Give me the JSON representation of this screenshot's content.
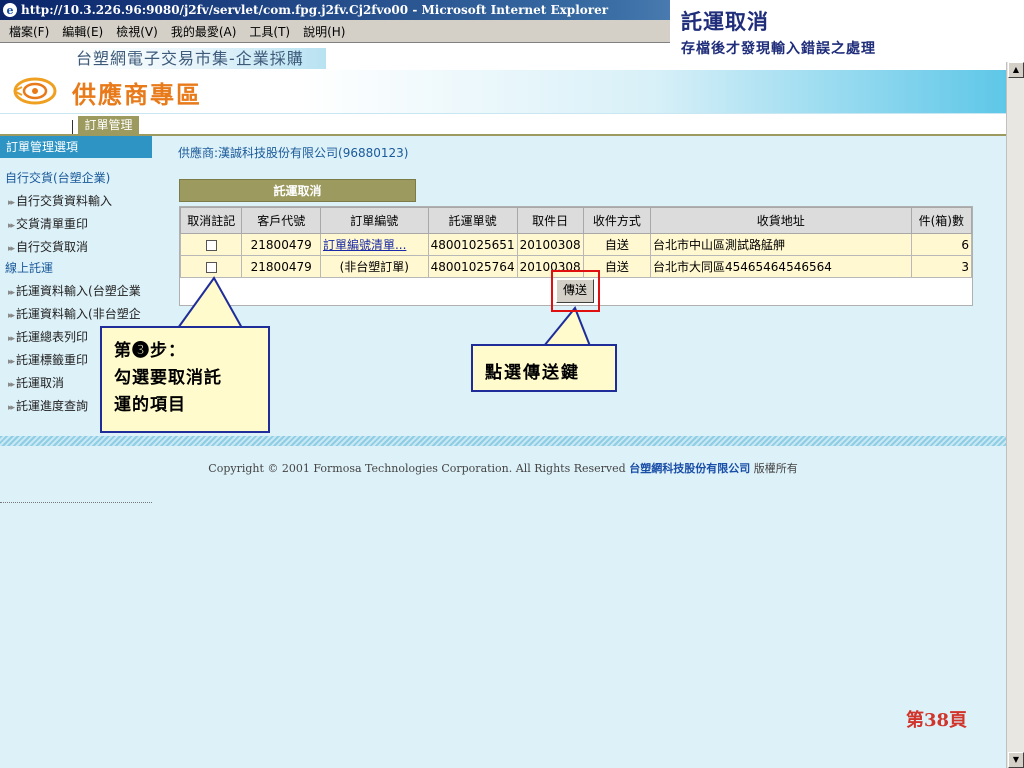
{
  "browser": {
    "title": "http://10.3.226.96:9080/j2fv/servlet/com.fpg.j2fv.Cj2fvo00 - Microsoft Internet Explorer",
    "menu": [
      "檔案(F)",
      "編輯(E)",
      "檢視(V)",
      "我的最愛(A)",
      "工具(T)",
      "說明(H)"
    ]
  },
  "slide": {
    "title": "託運取消",
    "subtitle": "存檔後才發現輸入錯誤之處理",
    "page": "第38頁"
  },
  "site": {
    "market": "台塑網電子交易市集-企業採購",
    "brand": "供應商專區",
    "active_tab": "訂單管理"
  },
  "nav": {
    "header": "訂單管理選項",
    "group1": "自行交貨(台塑企業)",
    "group1_items": [
      "自行交貨資料輸入",
      "交貨清單重印",
      "自行交貨取消"
    ],
    "group2": "線上託運",
    "group2_items": [
      "託運資料輸入(台塑企業",
      "託運資料輸入(非台塑企",
      "託運總表列印",
      "託運標籤重印",
      "託運取消",
      "託運進度查詢"
    ]
  },
  "supplier": "供應商:漢誠科技股份有限公司(96880123)",
  "panel": {
    "title": "託運取消",
    "columns": [
      "取消註記",
      "客戶代號",
      "訂單編號",
      "託運單號",
      "取件日",
      "收件方式",
      "收貨地址",
      "件(箱)數"
    ],
    "rows": [
      {
        "customer": "21800479",
        "order": "訂單編號清單...",
        "waybill": "48001025651",
        "pickup": "20100308",
        "method": "自送",
        "address": "台北市中山區測試路艋舺",
        "qty": "6"
      },
      {
        "customer": "21800479",
        "order": "(非台塑訂單)",
        "waybill": "48001025764",
        "pickup": "20100308",
        "method": "自送",
        "address": "台北市大同區45465464546564",
        "qty": "3"
      }
    ],
    "send_label": "傳送"
  },
  "callouts": {
    "step_line1": "第❸步：",
    "step_line2": "勾選要取消託",
    "step_line3": "運的項目",
    "send_hint": "點選傳送鍵"
  },
  "footer": {
    "copyright": "Copyright © 2001 Formosa Technologies Corporation. All Rights Reserved",
    "company": "台塑網科技股份有限公司",
    "rights": "版權所有"
  },
  "colors": {
    "accent_blue": "#2e94c4",
    "olive_tab": "#9c9a5e",
    "brand_orange": "#e87a1a",
    "callout_border": "#1f2d9a",
    "highlight_red": "#e01010"
  }
}
